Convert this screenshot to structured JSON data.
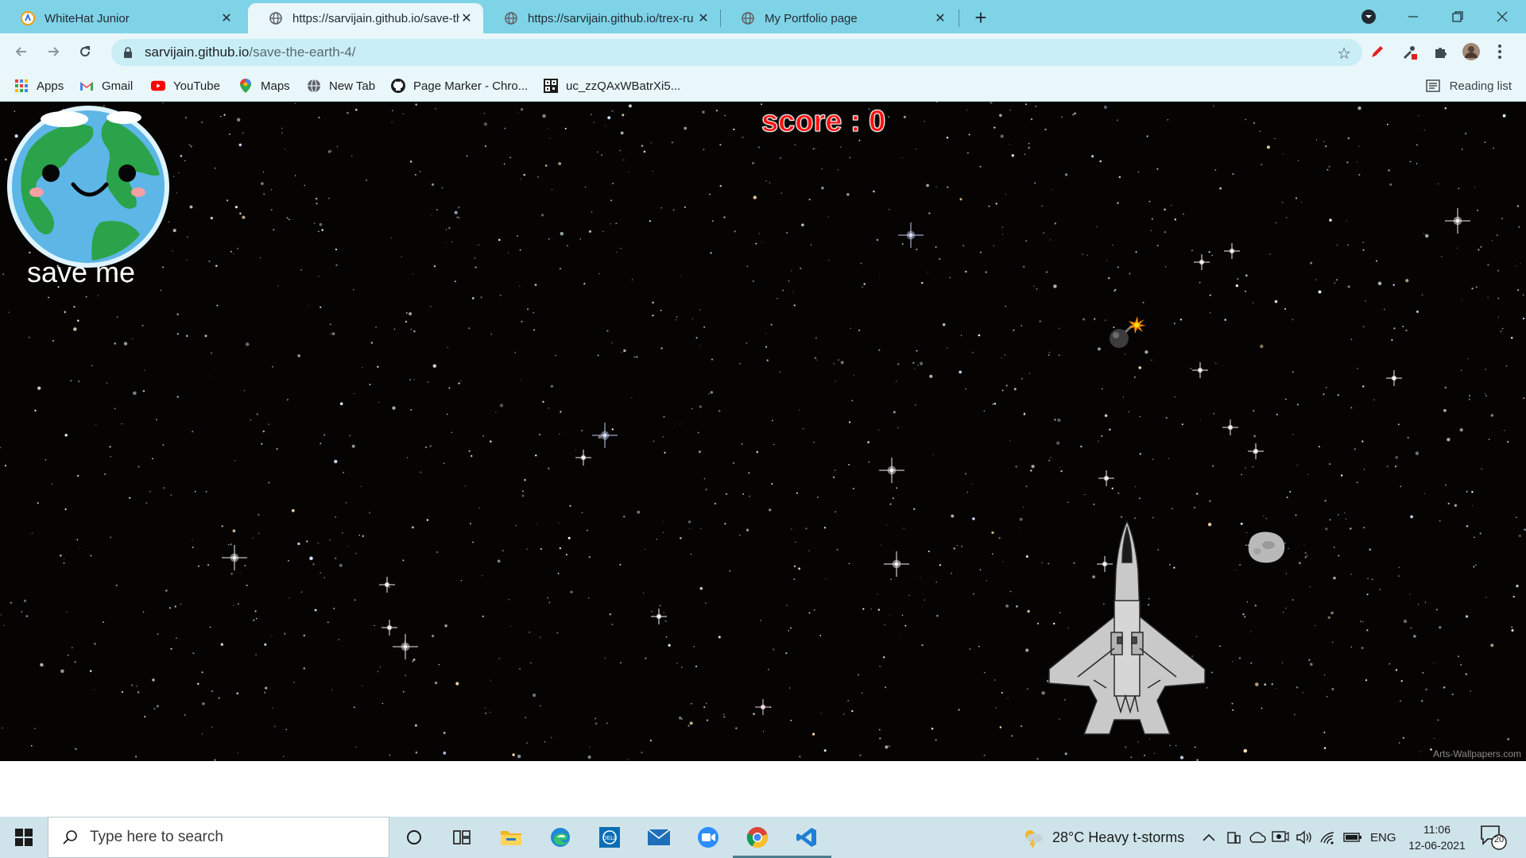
{
  "browser": {
    "tabs": [
      {
        "title": "WhiteHat Junior",
        "favicon": "whitehat-icon",
        "active": false
      },
      {
        "title": "https://sarvijain.github.io/save-th",
        "favicon": "globe-icon",
        "active": true
      },
      {
        "title": "https://sarvijain.github.io/trex-ru",
        "favicon": "globe-icon",
        "active": false
      },
      {
        "title": "My Portfolio page",
        "favicon": "globe-icon",
        "active": false
      }
    ],
    "url_host": "sarvijain.github.io",
    "url_path": "/save-the-earth-4/",
    "bookmarks": [
      {
        "label": "Apps",
        "icon": "apps-grid-icon"
      },
      {
        "label": "Gmail",
        "icon": "gmail-icon"
      },
      {
        "label": "YouTube",
        "icon": "youtube-icon"
      },
      {
        "label": "Maps",
        "icon": "maps-pin-icon"
      },
      {
        "label": "New Tab",
        "icon": "globe-icon"
      },
      {
        "label": "Page Marker - Chro...",
        "icon": "github-icon"
      },
      {
        "label": "uc_zzQAxWBatrXi5...",
        "icon": "qr-icon"
      }
    ],
    "reading_list": "Reading list"
  },
  "game": {
    "score_text": "score : 0",
    "earth_caption": "save me",
    "watermark": "Arts-Wallpapers.com"
  },
  "taskbar": {
    "search_placeholder": "Type here to search",
    "weather": "28°C  Heavy t-storms",
    "language": "ENG",
    "time": "11:06",
    "date": "12-06-2021",
    "notifications": "20"
  },
  "colors": {
    "tab_strip": "#7fd3e6",
    "toolbar": "#e9f7fb",
    "score": "#ff1010",
    "space": "#050403"
  }
}
